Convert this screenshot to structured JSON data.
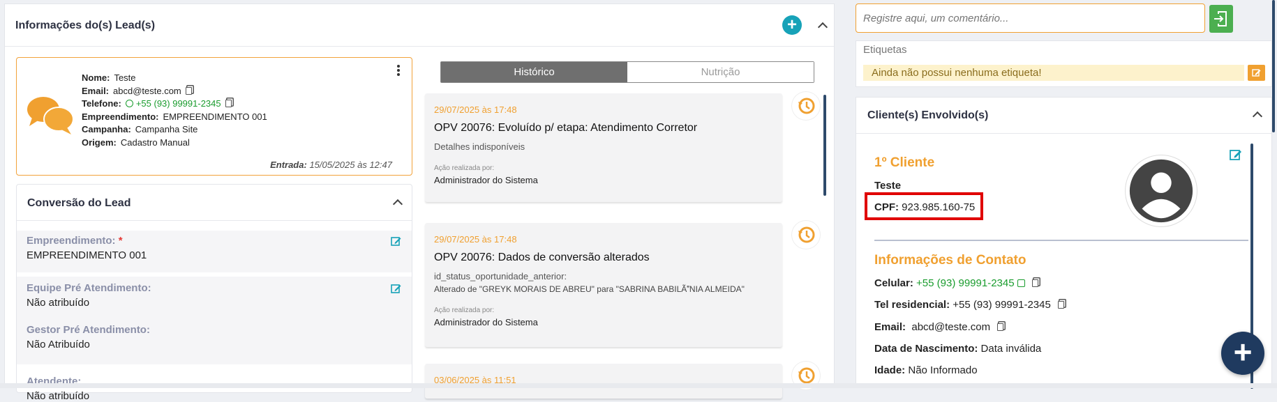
{
  "lead_panel": {
    "title": "Informações do(s) Lead(s)"
  },
  "info_card": {
    "nome_label": "Nome:",
    "nome": "Teste",
    "email_label": "Email:",
    "email": "abcd@teste.com",
    "telefone_label": "Telefone:",
    "telefone": "+55 (93) 99991-2345",
    "empreendimento_label": "Empreendimento:",
    "empreendimento": "EMPREENDIMENTO 001",
    "campanha_label": "Campanha:",
    "campanha": "Campanha Site",
    "origem_label": "Origem:",
    "origem": "Cadastro Manual",
    "entrada_label": "Entrada:",
    "entrada": "15/05/2025 às 12:47"
  },
  "conversion": {
    "title": "Conversão do Lead",
    "fields": [
      {
        "label": "Empreendimento:",
        "required": "*",
        "value": "EMPREENDIMENTO 001"
      },
      {
        "label": "Equipe Pré Atendimento:",
        "value": "Não atribuído"
      },
      {
        "label": "Gestor Pré Atendimento:",
        "value": "Não Atribuído"
      },
      {
        "label": "Atendente:",
        "value": "Não atribuído"
      }
    ]
  },
  "tabs": {
    "historico": "Histórico",
    "nutricao": "Nutrição"
  },
  "timeline": [
    {
      "date": "29/07/2025 às 17:48",
      "title": "OPV 20076: Evoluído p/ etapa: Atendimento Corretor",
      "detail": "Detalhes indisponíveis",
      "by_label": "Ação realizada por:",
      "by": "Administrador do Sistema"
    },
    {
      "date": "29/07/2025 às 17:48",
      "title": "OPV 20076: Dados de conversão alterados",
      "detail": "id_status_oportunidade_anterior:",
      "detail2": "Alterado de \"GREYK MORAIS DE ABREU\" para \"SABRINA BABILÃNIA ALMEIDA\"",
      "by_label": "Ação realizada por:",
      "by": "Administrador do Sistema"
    },
    {
      "date": "03/06/2025 às 11:51"
    }
  ],
  "comment": {
    "placeholder": "Registre aqui, um comentário..."
  },
  "etiquetas": {
    "label": "Etiquetas",
    "empty": "Ainda não possui nenhuma etiqueta!"
  },
  "clients": {
    "title": "Cliente(s) Envolvido(s)",
    "client_heading": "1º Cliente",
    "name": "Teste",
    "cpf_label": "CPF:",
    "cpf": "923.985.160-75",
    "contact_heading": "Informações de Contato",
    "celular_label": "Celular:",
    "celular": "+55 (93) 99991-2345",
    "tel_label": "Tel residencial:",
    "tel": "+55 (93) 99991-2345",
    "email_label": "Email:",
    "email": "abcd@teste.com",
    "nasc_label": "Data de Nascimento:",
    "nasc": "Data inválida",
    "idade_label": "Idade:",
    "idade": "Não Informado"
  },
  "colors": {
    "accent_orange": "#f0a030",
    "teal": "#17a2b8",
    "green": "#4caf50",
    "navy": "#1f3a5f",
    "highlight_red": "#e00000"
  },
  "icons": [
    "add-icon",
    "chevron-up-icon",
    "chat-bubbles-icon",
    "kebab-icon",
    "copy-icon",
    "whatsapp-icon",
    "edit-icon",
    "history-icon",
    "send-icon",
    "user-avatar-icon",
    "plus-icon"
  ]
}
